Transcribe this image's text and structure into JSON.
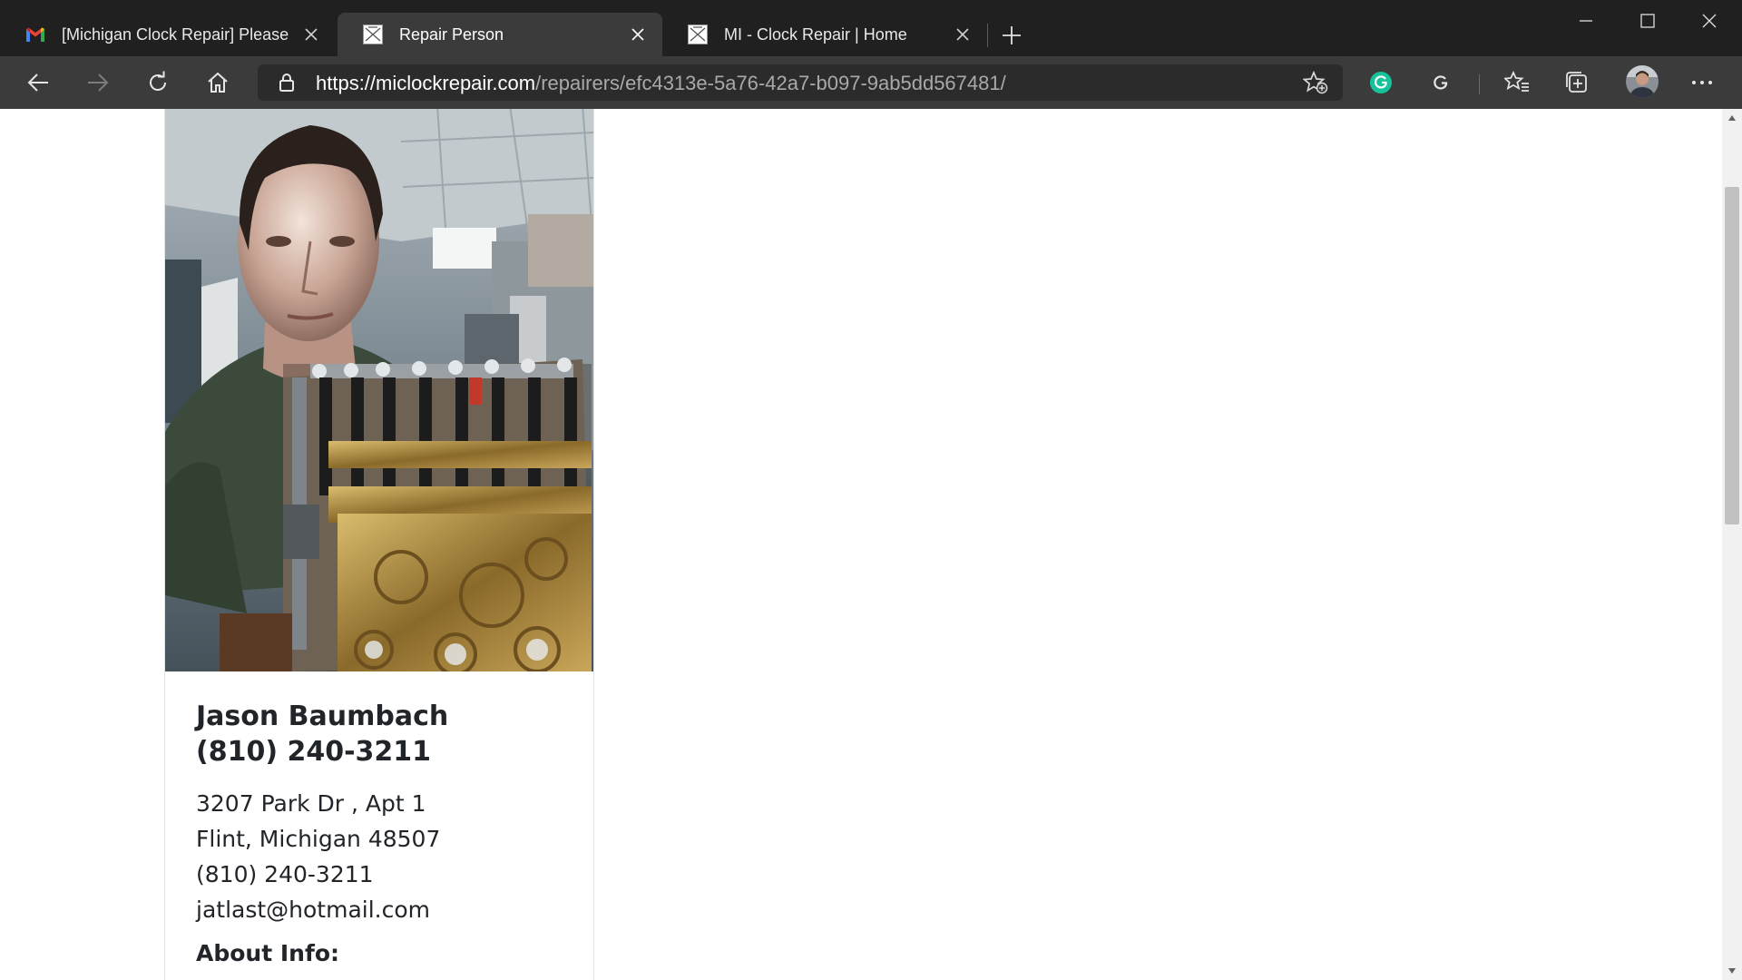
{
  "browser": {
    "tabs": [
      {
        "title": "[Michigan Clock Repair] Please C",
        "favicon": "gmail-icon",
        "active": false
      },
      {
        "title": "Repair Person",
        "favicon": "site-icon",
        "active": true
      },
      {
        "title": "MI - Clock Repair | Home",
        "favicon": "site-icon",
        "active": false
      }
    ],
    "address": {
      "scheme": "https://",
      "host": "miclockrepair.com",
      "path": "/repairers/efc4313e-5a76-42a7-b097-9ab5dd567481/"
    },
    "toolbar_icons": [
      "back-icon",
      "forward-icon",
      "refresh-icon",
      "home-icon",
      "lock-icon",
      "add-favorite-icon",
      "grammarly-icon",
      "grammarly-g-icon",
      "favorites-icon",
      "collections-icon",
      "profile-avatar",
      "more-icon"
    ],
    "colors": {
      "titlebar": "#202020",
      "toolbar": "#3b3b3b",
      "omnibox": "#2b2b2b",
      "grammarly": "#15c39a"
    }
  },
  "repairer": {
    "photo": "repairer-photo",
    "name": "Jason Baumbach",
    "phone_heading": "(810) 240-3211",
    "address_line1": "3207 Park Dr , Apt 1",
    "address_line2": "Flint, Michigan 48507",
    "phone": "(810) 240-3211",
    "email": "jatlast@hotmail.com",
    "about_label": "About Info:"
  }
}
